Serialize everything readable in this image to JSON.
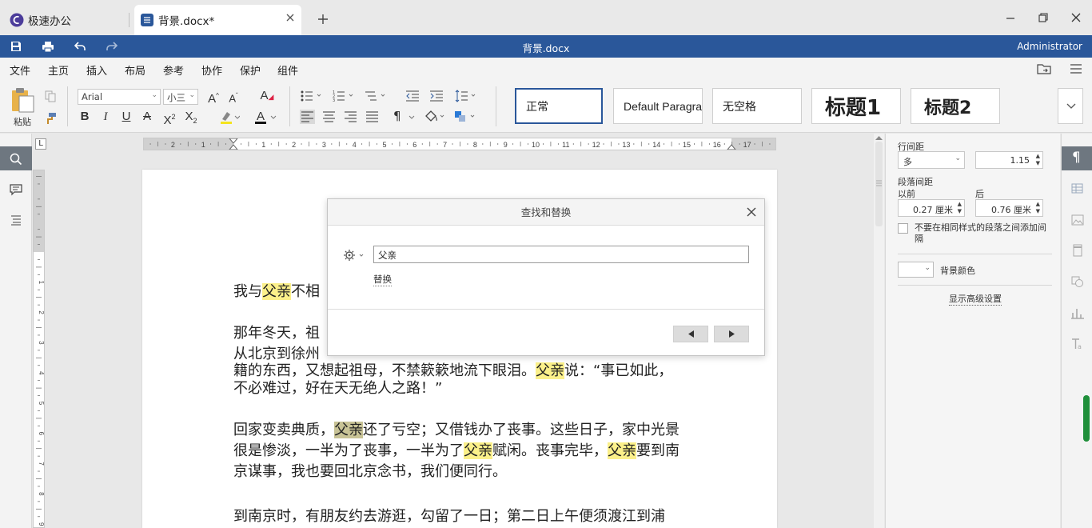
{
  "tabs": [
    {
      "label": "极速办公",
      "icon": "app-logo-icon"
    },
    {
      "label": "背景.docx*",
      "icon": "document-icon"
    }
  ],
  "titlebar": {
    "doc_title": "背景.docx",
    "user": "Administrator"
  },
  "menu": [
    "文件",
    "主页",
    "插入",
    "布局",
    "参考",
    "协作",
    "保护",
    "组件"
  ],
  "ribbon": {
    "paste_label": "粘贴",
    "font_name": "Arial",
    "font_size": "小三",
    "styles": [
      "正常",
      "Default Paragraph",
      "无空格",
      "标题1",
      "标题2"
    ]
  },
  "ruler": {
    "h_numbers": [
      "2",
      "1",
      "1",
      "2",
      "3",
      "4",
      "5",
      "6",
      "7",
      "8",
      "9",
      "10",
      "11",
      "12",
      "13",
      "14",
      "15",
      "16",
      "17"
    ],
    "v_numbers": [
      "1",
      "2",
      "3",
      "4",
      "5",
      "6",
      "7",
      "8",
      "9"
    ],
    "corner": "L"
  },
  "document": {
    "paragraphs": [
      [
        "我与",
        {
          "h": "父亲"
        },
        "不相"
      ],
      [
        "那年冬天，祖"
      ],
      [
        "从北京到徐州"
      ],
      [
        "籍的东西，又想起祖母，不禁簌簌地流下眼泪。",
        {
          "h": "父亲"
        },
        "说：“事已如此，"
      ],
      [
        "不必难过，好在天无绝人之路！”"
      ],
      [
        "回家变卖典质，",
        {
          "s": "父亲"
        },
        "还了亏空；又借钱办了丧事。这些日子，家中光景"
      ],
      [
        "很是惨淡，一半为了丧事，一半为了",
        {
          "h": "父亲"
        },
        "赋闲。丧事完毕，",
        {
          "h": "父亲"
        },
        "要到南"
      ],
      [
        "京谋事，我也要回北京念书，我们便同行。"
      ],
      [
        "到南京时，有朋友约去游逛，勾留了一日；第二日上午便须渡江到浦"
      ]
    ]
  },
  "dialog": {
    "title": "查找和替换",
    "search_value": "父亲",
    "replace_link": "替换"
  },
  "right_panel": {
    "line_spacing_label": "行间距",
    "line_spacing_mode": "多",
    "line_spacing_value": "1.15",
    "para_spacing_label": "段落间距",
    "before_label": "以前",
    "after_label": "后",
    "before_value": "0.27 厘米",
    "after_value": "0.76 厘米",
    "no_space_same_style": "不要在相同样式的段落之间添加间隔",
    "bg_color_label": "背景颜色",
    "advanced_link": "显示高级设置"
  }
}
